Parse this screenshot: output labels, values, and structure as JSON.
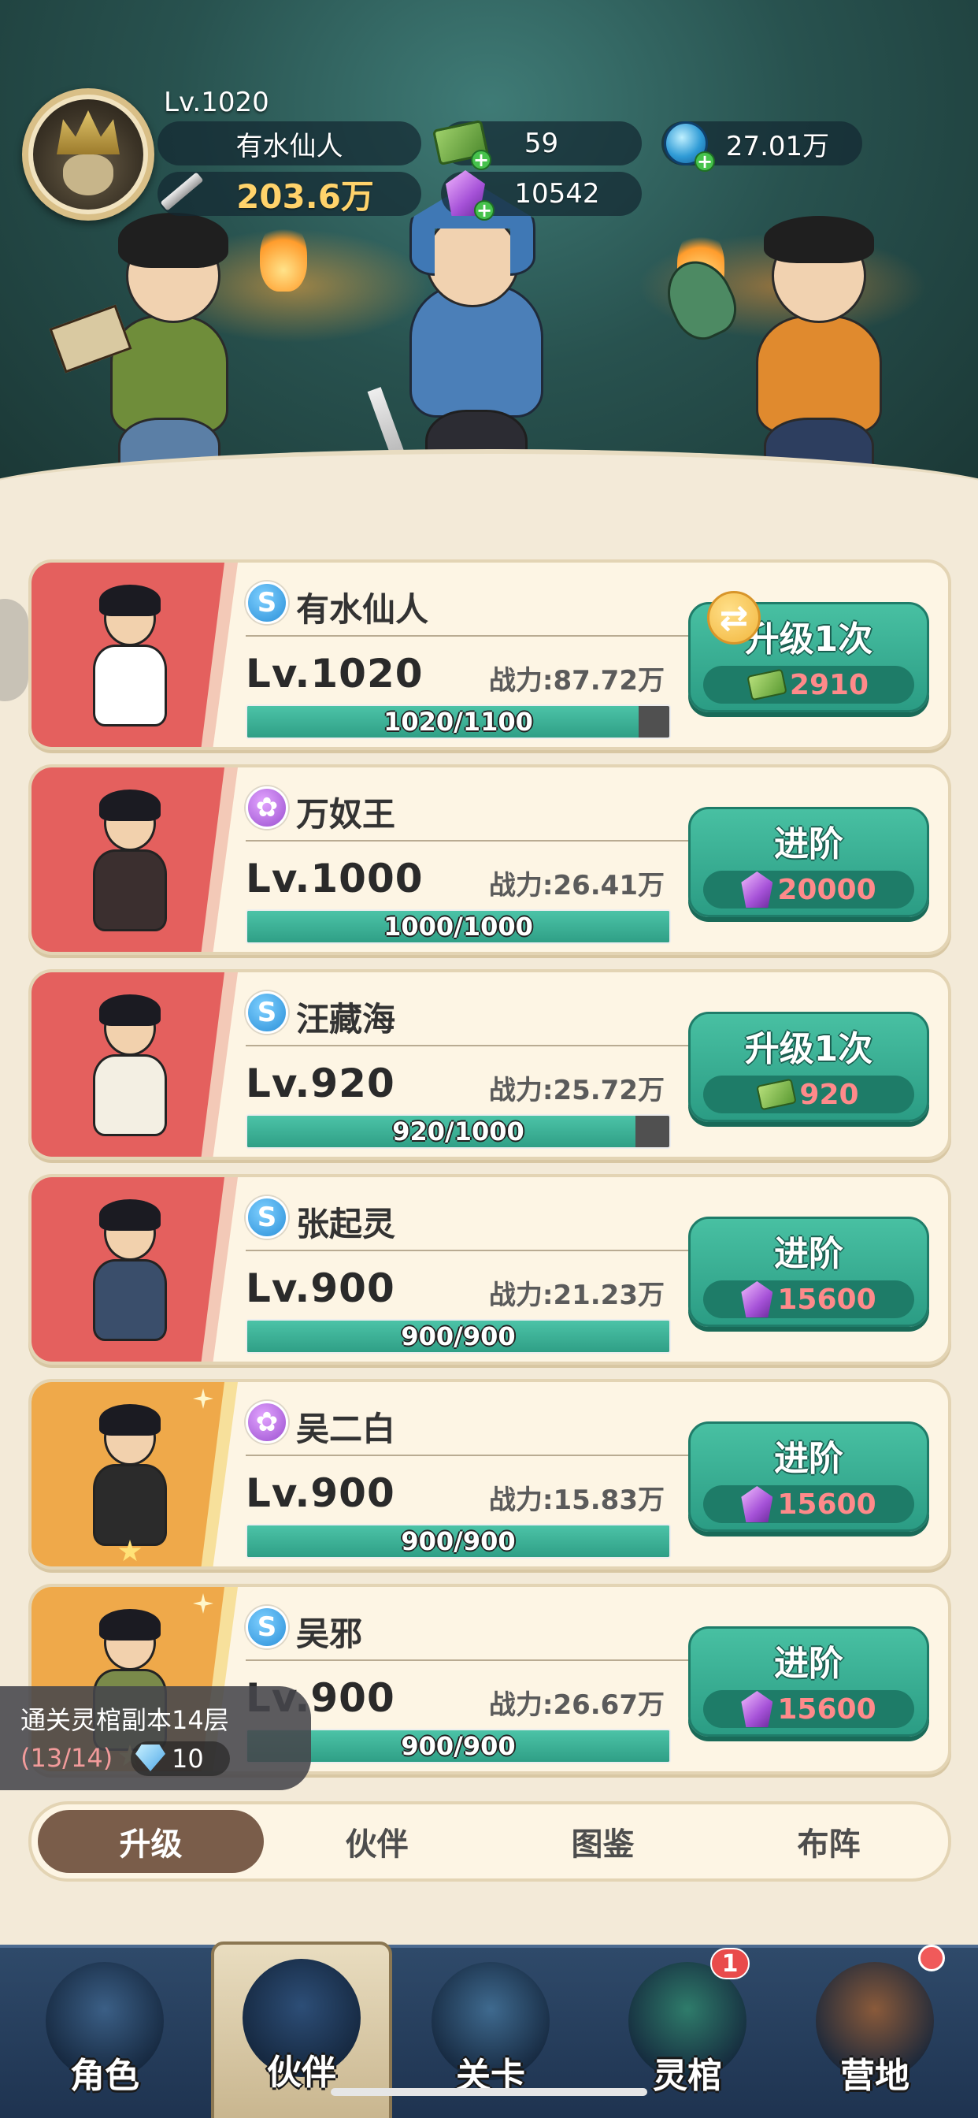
{
  "player": {
    "level": "Lv.1020",
    "name": "有水仙人",
    "power": "203.6万",
    "cash": "59",
    "gems": "10542",
    "orbs": "27.01万"
  },
  "heroes": [
    {
      "type": "s",
      "name": "有水仙人",
      "level": "Lv.1020",
      "power": "战力:87.72万",
      "xp": "1020/1100",
      "xp_fraction": 0.927,
      "action": "升级1次",
      "cost_kind": "cash",
      "cost": "2910",
      "rarity": "red",
      "swap": true
    },
    {
      "type": "lotus",
      "name": "万奴王",
      "level": "Lv.1000",
      "power": "战力:26.41万",
      "xp": "1000/1000",
      "xp_fraction": 1.0,
      "action": "进阶",
      "cost_kind": "gem",
      "cost": "20000",
      "rarity": "red",
      "swap": false
    },
    {
      "type": "s",
      "name": "汪藏海",
      "level": "Lv.920",
      "power": "战力:25.72万",
      "xp": "920/1000",
      "xp_fraction": 0.92,
      "action": "升级1次",
      "cost_kind": "cash",
      "cost": "920",
      "rarity": "red",
      "swap": false
    },
    {
      "type": "s",
      "name": "张起灵",
      "level": "Lv.900",
      "power": "战力:21.23万",
      "xp": "900/900",
      "xp_fraction": 1.0,
      "action": "进阶",
      "cost_kind": "gem",
      "cost": "15600",
      "rarity": "red",
      "swap": false
    },
    {
      "type": "lotus",
      "name": "吴二白",
      "level": "Lv.900",
      "power": "战力:15.83万",
      "xp": "900/900",
      "xp_fraction": 1.0,
      "action": "进阶",
      "cost_kind": "gem",
      "cost": "15600",
      "rarity": "gold",
      "swap": false
    },
    {
      "type": "s",
      "name": "吴邪",
      "level": "Lv.900",
      "power": "战力:26.67万",
      "xp": "900/900",
      "xp_fraction": 1.0,
      "action": "进阶",
      "cost_kind": "gem",
      "cost": "15600",
      "rarity": "gold",
      "swap": false
    }
  ],
  "task": {
    "title": "通关灵棺副本14层",
    "progress": "(13/14)",
    "reward": "10"
  },
  "subtabs": [
    "升级",
    "伙伴",
    "图鉴",
    "布阵"
  ],
  "active_subtab": 0,
  "nav": [
    {
      "label": "角色",
      "color": "#3b5f86"
    },
    {
      "label": "伙伴",
      "color": "#2d4e77"
    },
    {
      "label": "关卡",
      "color": "#3f6a8f"
    },
    {
      "label": "灵棺",
      "color": "#2f7c6b",
      "badge": "1"
    },
    {
      "label": "营地",
      "color": "#8a5a3a",
      "dot": true
    }
  ],
  "active_nav": 1,
  "colors": {
    "accent_green": "#2f9f86",
    "red_card": "#e4605e",
    "gold_card": "#efa94a",
    "cost_red": "#ff8a8a"
  }
}
